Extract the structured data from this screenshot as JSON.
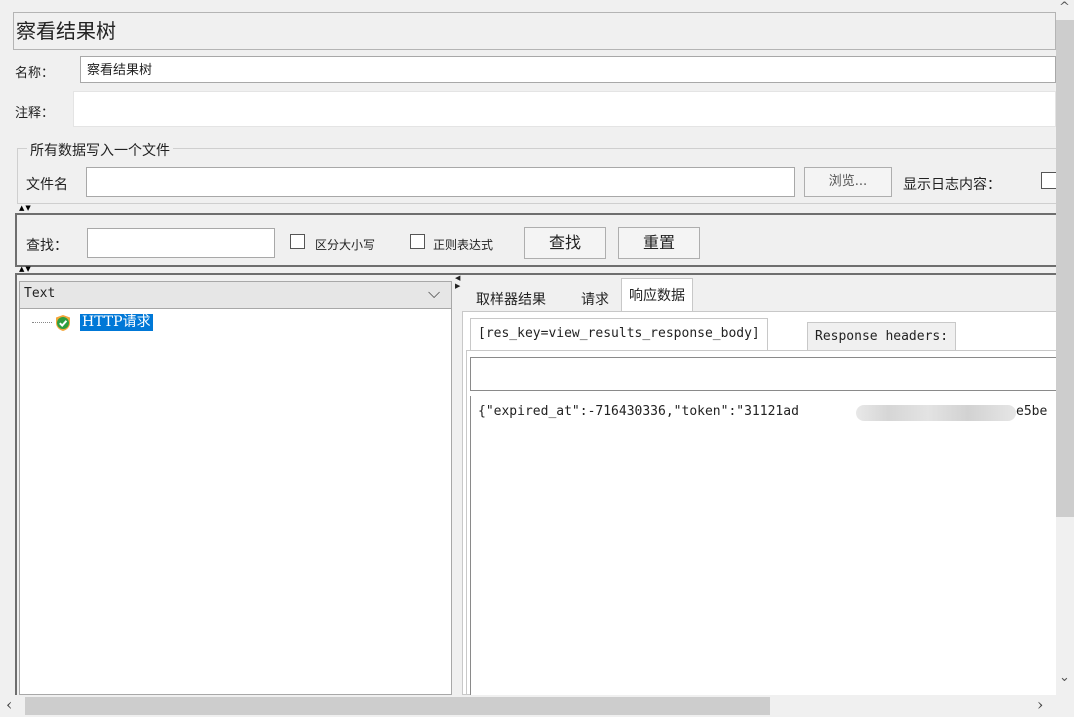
{
  "panel": {
    "title": "察看结果树",
    "name_label": "名称：",
    "name_value": "察看结果树",
    "comment_label": "注释：",
    "comment_value": ""
  },
  "file_section": {
    "legend": "所有数据写入一个文件",
    "filename_label": "文件名",
    "filename_value": "",
    "browse_label": "浏览...",
    "log_label": "显示日志内容："
  },
  "search": {
    "label": "查找：",
    "value": "",
    "case_label": "区分大小写",
    "regex_label": "正则表达式",
    "find_label": "查找",
    "reset_label": "重置"
  },
  "tree": {
    "renderer": "Text",
    "items": [
      {
        "label": "HTTP请求",
        "status": "success"
      }
    ]
  },
  "result_tabs": [
    {
      "label": "取样器结果",
      "active": false
    },
    {
      "label": "请求",
      "active": false
    },
    {
      "label": "响应数据",
      "active": true
    }
  ],
  "response_subtabs": [
    {
      "label": "[res_key=view_results_response_body]",
      "active": true
    },
    {
      "label": "Response headers:",
      "active": false
    }
  ],
  "response": {
    "search_value": "",
    "body_start": "{\"expired_at\":-716430336,\"token\":\"31121ad",
    "body_end": "e5be"
  },
  "colors": {
    "selection": "#0078d7",
    "success_icon": "#2e9e3e",
    "scrollbar_thumb": "#cdcdcd"
  }
}
